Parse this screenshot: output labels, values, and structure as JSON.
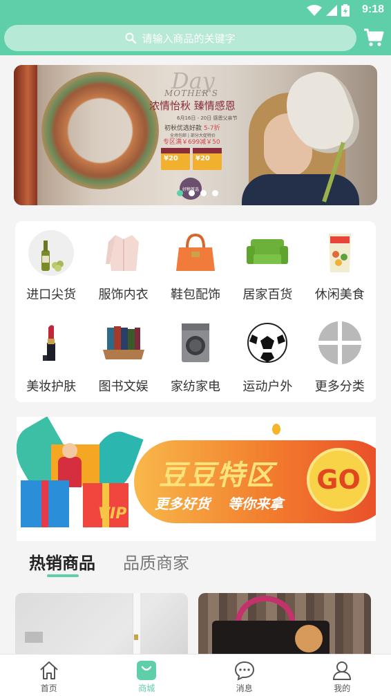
{
  "status_bar": {
    "time": "9:18"
  },
  "search": {
    "placeholder": "请输入商品的关键字"
  },
  "banner": {
    "day_script": "Day",
    "mothers_script": "MOTHER'S",
    "title": "浓情怡秋  臻情感恩",
    "date_text": "6月16日 - 20日  感恩父亲节",
    "line1": "初秋优选好款 ",
    "line1_highlight": "5-7折",
    "sub_text": "全场包邮 | 部分大促特价",
    "line2": "专区满￥699减￥50",
    "coupon1": "¥20",
    "coupon2": "¥20",
    "badge_text": "好物首选",
    "slide_count": 4,
    "active_slide": 0
  },
  "categories": [
    {
      "label": "进口尖货",
      "icon": "wine-icon"
    },
    {
      "label": "服饰内衣",
      "icon": "blouse-icon"
    },
    {
      "label": "鞋包配饰",
      "icon": "handbag-icon"
    },
    {
      "label": "居家百货",
      "icon": "sofa-icon"
    },
    {
      "label": "休闲美食",
      "icon": "snack-bag-icon"
    },
    {
      "label": "美妆护肤",
      "icon": "lipstick-icon"
    },
    {
      "label": "图书文娱",
      "icon": "books-icon"
    },
    {
      "label": "家纺家电",
      "icon": "washing-machine-icon"
    },
    {
      "label": "运动户外",
      "icon": "soccer-ball-icon"
    },
    {
      "label": "更多分类",
      "icon": "more-categories-icon"
    }
  ],
  "promo": {
    "title": "豆豆特区",
    "sub1": "更多好货",
    "sub2": "等你来拿",
    "go": "GO",
    "vip": "VIP"
  },
  "tabs": [
    {
      "label": "热销商品",
      "active": true
    },
    {
      "label": "品质商家",
      "active": false
    }
  ],
  "bottom_nav": [
    {
      "label": "首页",
      "icon": "home-icon",
      "active": false
    },
    {
      "label": "商城",
      "icon": "shopping-bag-icon",
      "active": true
    },
    {
      "label": "消息",
      "icon": "message-icon",
      "active": false
    },
    {
      "label": "我的",
      "icon": "user-icon",
      "active": false
    }
  ],
  "colors": {
    "primary": "#5ecfa8",
    "search_bg": "#b6e9d6"
  }
}
